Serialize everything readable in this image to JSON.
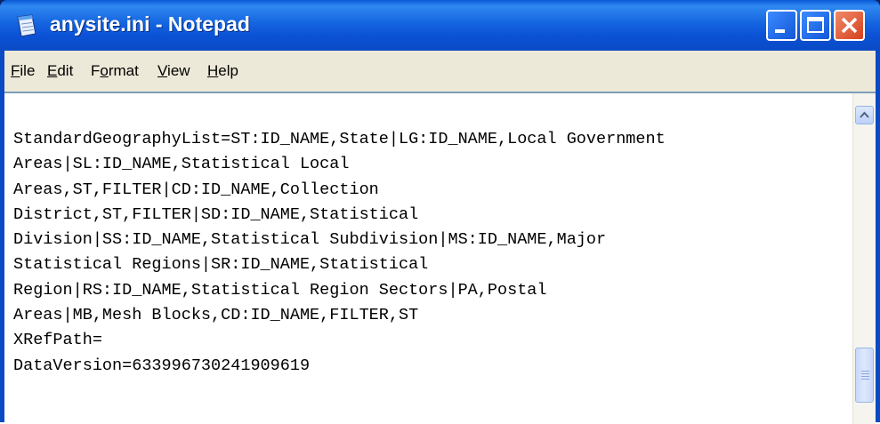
{
  "window": {
    "title": "anysite.ini - Notepad",
    "accent_color": "#0b52d6",
    "close_color": "#d6401c"
  },
  "icons": {
    "app": "notepad-icon",
    "minimize": "minimize-icon",
    "maximize": "maximize-icon",
    "close": "close-icon",
    "scroll_up": "chevron-up-icon"
  },
  "menu": [
    {
      "label": "File",
      "mnemonic": "F"
    },
    {
      "label": "Edit",
      "mnemonic": "E"
    },
    {
      "label": "Format",
      "mnemonic": "o"
    },
    {
      "label": "View",
      "mnemonic": "V"
    },
    {
      "label": "Help",
      "mnemonic": "H"
    }
  ],
  "editor": {
    "lines": [
      "StandardGeographyList=ST:ID_NAME,State|LG:ID_NAME,Local Government",
      "Areas|SL:ID_NAME,Statistical Local",
      "Areas,ST,FILTER|CD:ID_NAME,Collection",
      "District,ST,FILTER|SD:ID_NAME,Statistical",
      "Division|SS:ID_NAME,Statistical Subdivision|MS:ID_NAME,Major",
      "Statistical Regions|SR:ID_NAME,Statistical",
      "Region|RS:ID_NAME,Statistical Region Sectors|PA,Postal",
      "Areas|MB,Mesh Blocks,CD:ID_NAME,FILTER,ST",
      "XRefPath=",
      "DataVersion=633996730241909619"
    ]
  }
}
